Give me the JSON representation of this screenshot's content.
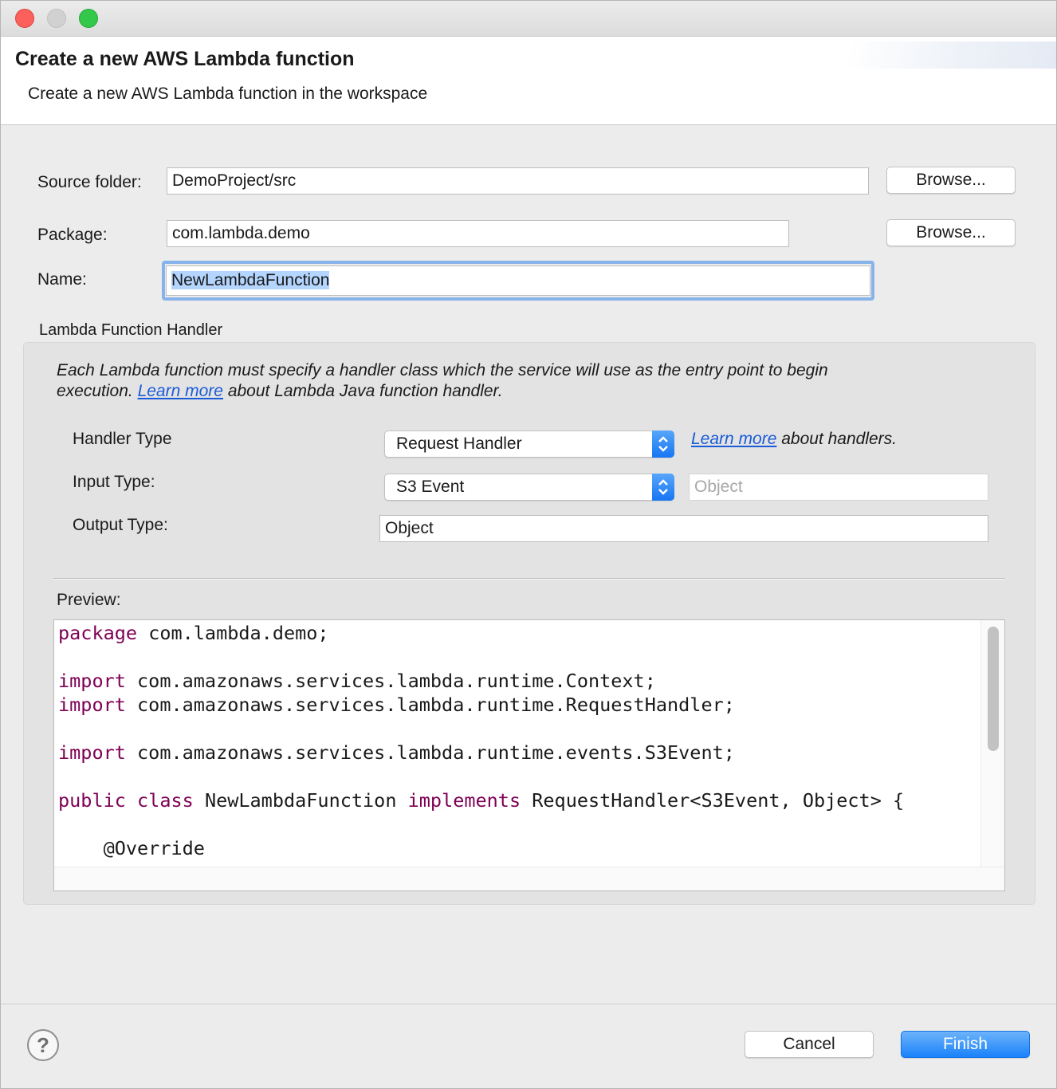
{
  "window": {
    "controls": [
      "close",
      "minimize",
      "zoom"
    ]
  },
  "header": {
    "title": "Create a new AWS Lambda function",
    "description": "Create a new AWS Lambda function in the workspace"
  },
  "form": {
    "source_folder_label": "Source folder:",
    "source_folder_value": "DemoProject/src",
    "package_label": "Package:",
    "package_value": "com.lambda.demo",
    "name_label": "Name:",
    "name_value": "NewLambdaFunction",
    "browse_label": "Browse..."
  },
  "handler_group": {
    "title": "Lambda Function Handler",
    "description_part1": "Each Lambda function must specify a handler class which the service will use as the entry point to begin",
    "description_part2": "execution.",
    "learn_more": "Learn more",
    "description_part3": "about Lambda Java function handler.",
    "handler_type_label": "Handler Type",
    "handler_type_value": "Request Handler",
    "handlers_learn_more": "Learn more",
    "handlers_link_suffix": "about handlers.",
    "input_type_label": "Input Type:",
    "input_type_value": "S3 Event",
    "input_type_custom_placeholder": "Object",
    "output_type_label": "Output Type:",
    "output_type_value": "Object",
    "preview_label": "Preview:"
  },
  "preview": {
    "line1_kw": "package",
    "line1_rest": " com.lambda.demo;",
    "line2_kw": "import",
    "line2_rest": " com.amazonaws.services.lambda.runtime.Context;",
    "line3_kw": "import",
    "line3_rest": " com.amazonaws.services.lambda.runtime.RequestHandler;",
    "line4_kw": "import",
    "line4_rest": " com.amazonaws.services.lambda.runtime.events.S3Event;",
    "line5_kw1": "public",
    "line5_kw2": "class",
    "line5_mid": " NewLambdaFunction ",
    "line5_kw3": "implements",
    "line5_rest": " RequestHandler<S3Event, Object> {",
    "line6": "    @Override"
  },
  "footer": {
    "help": "?",
    "cancel_label": "Cancel",
    "finish_label": "Finish"
  },
  "colors": {
    "keyword": "#7f0055",
    "link": "#1a5bd8",
    "primary_button": "#1a82fb",
    "selection": "#b4d5fe"
  }
}
